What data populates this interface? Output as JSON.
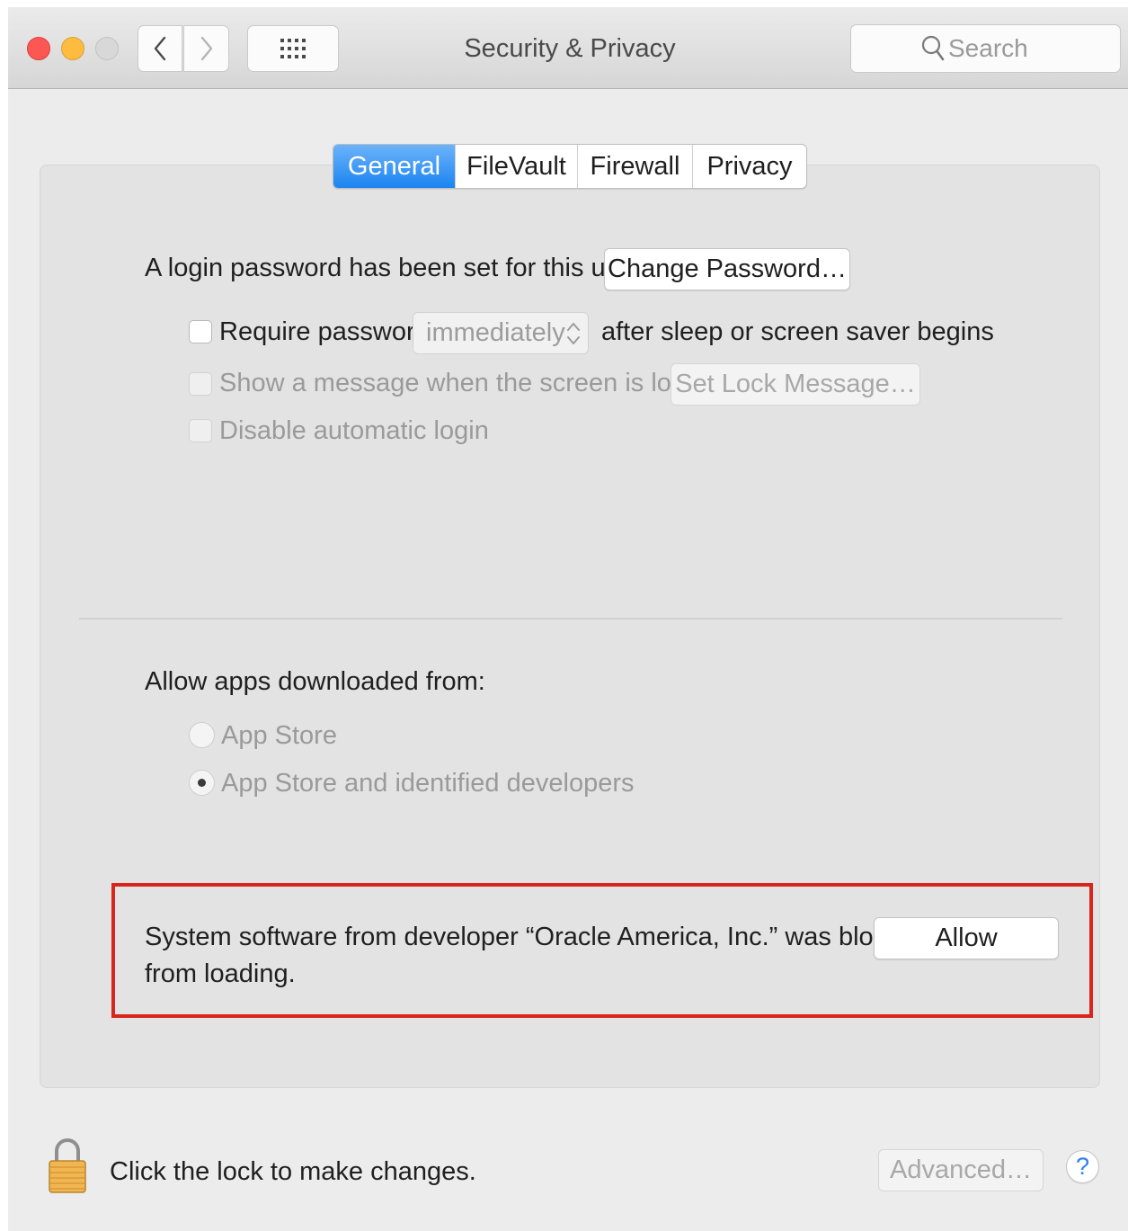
{
  "window": {
    "title": "Security & Privacy",
    "search_placeholder": "Search",
    "traffic_lights": [
      "close",
      "minimize",
      "zoom"
    ]
  },
  "tabs": [
    {
      "label": "General",
      "active": true
    },
    {
      "label": "FileVault",
      "active": false
    },
    {
      "label": "Firewall",
      "active": false
    },
    {
      "label": "Privacy",
      "active": false
    }
  ],
  "general": {
    "login_text": "A login password has been set for this user",
    "change_password_label": "Change Password…",
    "require_password": {
      "label": "Require password",
      "checked": false,
      "enabled": true
    },
    "require_select_value": "immediately",
    "after_sleep_text": "after sleep or screen saver begins",
    "show_message": {
      "label": "Show a message when the screen is locked",
      "checked": false,
      "enabled": false
    },
    "set_lock_message_label": "Set Lock Message…",
    "disable_auto_login": {
      "label": "Disable automatic login",
      "checked": false,
      "enabled": false
    }
  },
  "downloads": {
    "heading": "Allow apps downloaded from:",
    "options": [
      {
        "label": "App Store",
        "selected": false
      },
      {
        "label": "App Store and identified developers",
        "selected": true
      }
    ]
  },
  "blocked": {
    "line1": "System software from developer “Oracle America, Inc.” was blocked",
    "line2": "from loading.",
    "allow_label": "Allow",
    "highlight_color": "#d9261c"
  },
  "footer": {
    "lock_text": "Click the lock to make changes.",
    "advanced_label": "Advanced…",
    "help_label": "?"
  },
  "colors": {
    "accent": "#1b84f1",
    "close": "#fc5753",
    "minimize": "#fdbc40",
    "zoom_disabled": "#d8d8d8"
  }
}
